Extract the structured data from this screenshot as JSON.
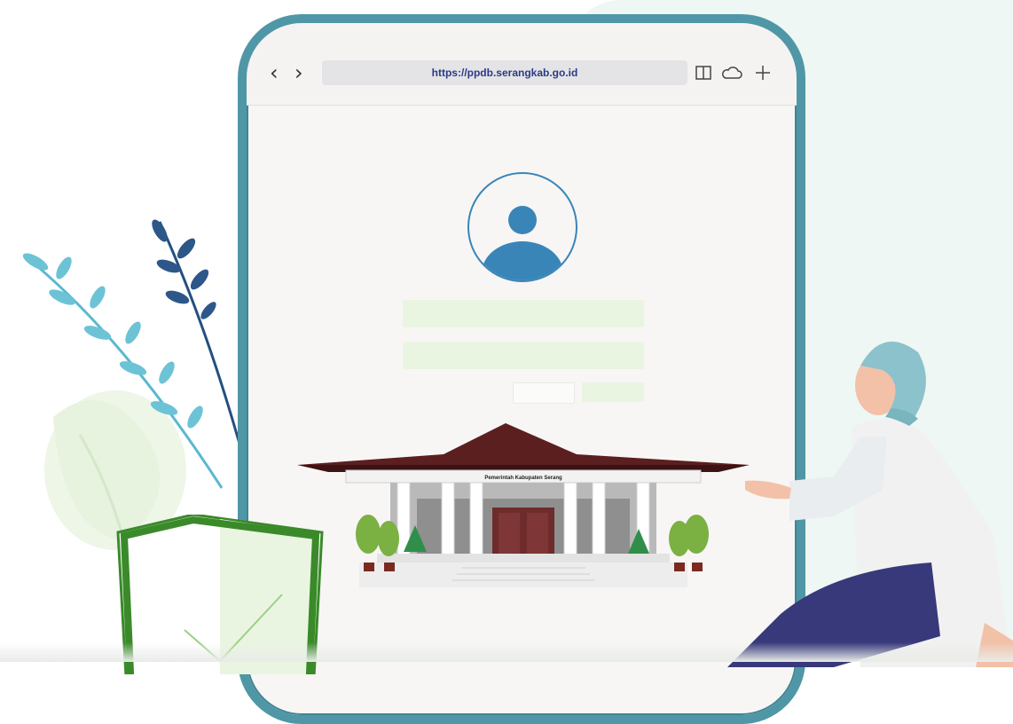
{
  "browser": {
    "url": "https://ppdb.serangkab.go.id",
    "icons": [
      "chevron-left-icon",
      "chevron-right-icon",
      "reader-view-icon",
      "cloud-icon",
      "plus-icon"
    ]
  },
  "building": {
    "sign": "Pemerintah Kabupaten Serang"
  },
  "colors": {
    "phone_frame": "#4f97a6",
    "avatar": "#3a85b8",
    "field": "#eaf5e1",
    "roof": "#5b1f1f",
    "shield": "#3a8a2a",
    "hijab": "#8cc2cb",
    "pants": "#37397a"
  }
}
